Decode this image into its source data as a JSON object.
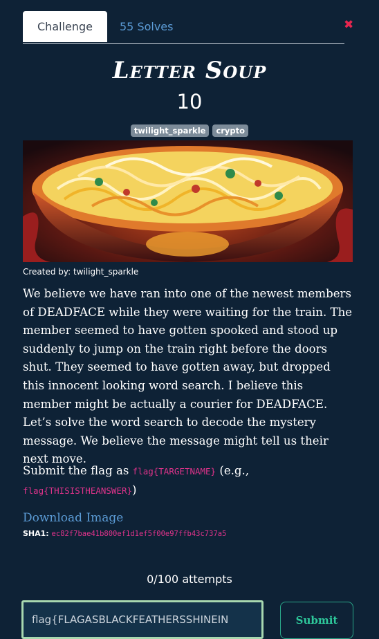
{
  "tabs": [
    {
      "label": "Challenge",
      "active": true
    },
    {
      "label": "55 Solves",
      "active": false
    }
  ],
  "close_icon": "close-icon",
  "challenge": {
    "title": "Letter Soup",
    "points": "10",
    "tags": [
      "twilight_sparkle",
      "crypto"
    ],
    "image_alt": "bowl-of-noodle-soup-image",
    "credit": "Created by: twilight_sparkle",
    "description": "We believe we have ran into one of the newest members of DEADFACE while they were waiting for the train. The member seemed to have gotten spooked and stood up suddenly to jump on the train right before the doors shut. They seemed to have gotten away, but dropped this innocent looking word search. I believe this member might be actually a courier for DEADFACE. Let’s solve the word search to decode the mystery message. We believe the message might tell us their next move.",
    "submit_prefix": "Submit the flag as ",
    "flag_format": "flag{TARGETNAME}",
    "submit_mid": " (e.g., ",
    "flag_example": "flag{THISISTHEANSWER}",
    "submit_suffix": ")",
    "download_label": "Download Image",
    "sha1_label": "SHA1:",
    "sha1_value": "ec82f7bae41b800ef1d1ef5f00e97ffb43c737a5"
  },
  "attempts": "0/100 attempts",
  "flag_input_value": "flag{FLAGASBLACKFEATHERSSHINEIN",
  "submit_label": "Submit",
  "colors": {
    "background": "#0e2236",
    "link": "#5b9bd5",
    "code": "#e0338b",
    "submit": "#2ec89b",
    "close": "#e8264f"
  }
}
